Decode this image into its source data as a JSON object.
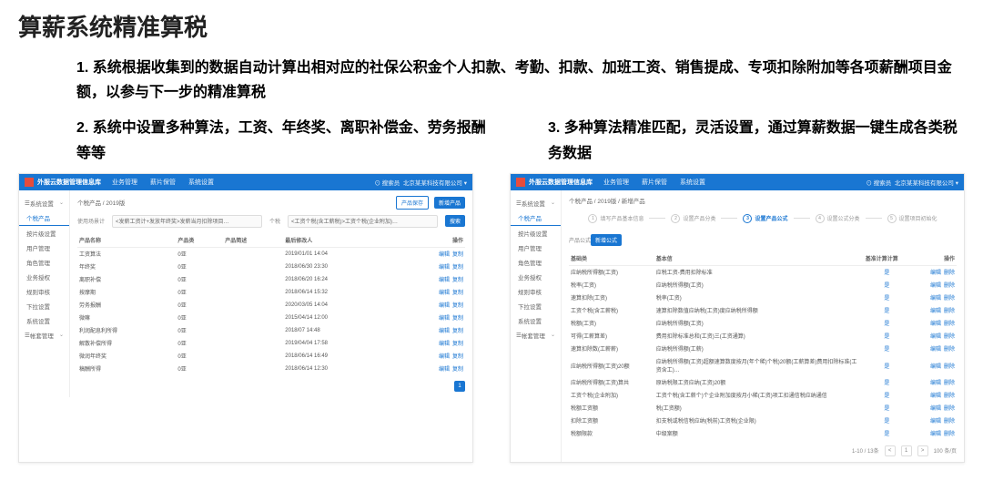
{
  "title": "算薪系统精准算税",
  "desc1": "1. 系统根据收集到的数据自动计算出相对应的社保公积金个人扣款、考勤、扣款、加班工资、销售提成、专项扣除附加等各项薪酬项目金额，以参与下一步的精准算税",
  "desc2": "2. 系统中设置多种算法，工资、年终奖、离职补偿金、劳务报酬等等",
  "desc3": "3. 多种算法精准匹配，灵活设置，通过算薪数据一键生成各类税务数据",
  "topbar": {
    "brand": "外服云数据管理信息库",
    "navs": [
      "业务管理",
      "薪片保管",
      "系统设置"
    ],
    "search": "搜索员",
    "company": "北京某某科技有限公司"
  },
  "sidebar": {
    "head": "系统设置",
    "items": [
      "个税产品",
      "按片级设置",
      "用户管理",
      "角色管理",
      "业务授权",
      "规则审核",
      "下拉设置",
      "系统设置"
    ],
    "extra": "帐套管理"
  },
  "left": {
    "crumb": "个税产品 / 2019版",
    "btns": [
      "产品保存",
      "新增产品"
    ],
    "filters": {
      "f1lbl": "使用场景计",
      "f1": "<发薪工资计+发放年终奖>发薪当月扣除项目…",
      "f2lbl": "个税",
      "f2": "<工资个税(含工薪税)>工资个税(企业附加)…",
      "sbtn": "搜索"
    },
    "thead": [
      "产品名称",
      "产品类",
      "产品简述",
      "最后修改人",
      "操作"
    ],
    "rows": [
      [
        "工资算法",
        "0亚",
        "",
        "2019/01/01 14:04"
      ],
      [
        "年终奖",
        "0亚",
        "",
        "2018/06/30 23:30"
      ],
      [
        "离职补偿",
        "0亚",
        "",
        "2018/06/20 16:24"
      ],
      [
        "按摩期",
        "0亚",
        "",
        "2018/06/14 15:32"
      ],
      [
        "劳务报酬",
        "0亚",
        "",
        "2020/03/05 14:04"
      ],
      [
        "微嘛",
        "0亚",
        "",
        "2015/04/14 12:00"
      ],
      [
        "利润配息利所得",
        "0亚",
        "",
        "2018/07 14:48"
      ],
      [
        "解散补偿所得",
        "0亚",
        "",
        "2019/04/04 17:58"
      ],
      [
        "微润年终奖",
        "0亚",
        "",
        "2018/06/14 16:49"
      ],
      [
        "稿酬所得",
        "0亚",
        "",
        "2018/06/14 12:30"
      ]
    ],
    "act": [
      "编辑",
      "复制"
    ],
    "page": "1"
  },
  "right": {
    "crumb": "个税产品 / 2019版 / 新增产品",
    "steps": [
      "填写产品基本信息",
      "设置产品分类",
      "设置产品公式",
      "设置公式分类",
      "设置项目初始化"
    ],
    "activeStep": 3,
    "sublbl": "产品公式",
    "subbtn": "新增公式",
    "thead": [
      "基础类",
      "基本信",
      "基准计算计算",
      "操作"
    ],
    "rows": [
      [
        "应纳税所得额(工资)",
        "应税工资-费用扣除标准",
        "是"
      ],
      [
        "税率(工资)",
        "应纳税所得额(工资)",
        "是"
      ],
      [
        "速算扣除(工资)",
        "税率(工资)",
        "是"
      ],
      [
        "工资个税(含工薪税)",
        "速算扣除数值应纳税(工资)度应纳税所得额",
        "是"
      ],
      [
        "税额(工资)",
        "应纳税所得额(工资)",
        "是"
      ],
      [
        "可得(工薪算差)",
        "费用扣除标准总和(工资)三(工资通算)",
        "是"
      ],
      [
        "速算扣除数(工薪薪)",
        "应纳税所得额(工薪)",
        "是"
      ],
      [
        "应纳税所得额(工资)20额",
        "应纳税所得额(工资)超额速算数度按月(年个稀)个税)20额(工薪算差)费用扣除标准(工资含工)…",
        "是"
      ],
      [
        "应纳税所得额(工资)算共",
        "原纳税限工资应纳(工资)20额",
        "是"
      ],
      [
        "工资个税(企业附加)",
        "工资个税(含工薪个)个企业附加度按月小稀(工资)项工扣通信税应纳通信",
        "是"
      ],
      [
        "税额工资额",
        "税(工资额)",
        "是"
      ],
      [
        "扣除工资额",
        "扣支税或税信税应纳(税前)工资税(企业限)",
        "是"
      ],
      [
        "税额限款",
        "中级案额",
        "是"
      ]
    ],
    "act": [
      "编辑",
      "删除"
    ],
    "pager": {
      "range": "1-10 / 13条",
      "prev": "<",
      "page": "1",
      "next": ">",
      "total": "100 条/页"
    }
  }
}
